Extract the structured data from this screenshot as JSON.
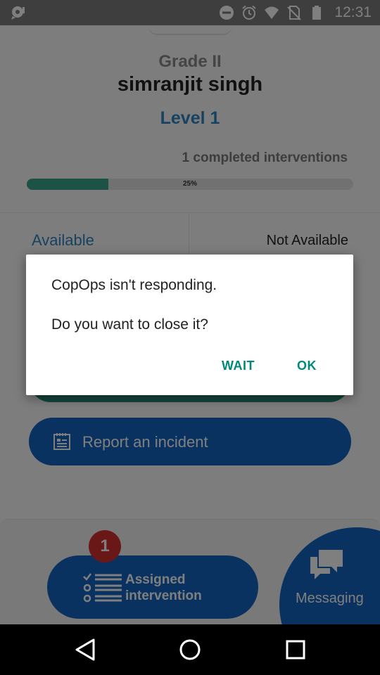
{
  "status_bar": {
    "time": "12:31",
    "icons": [
      "notification-icon",
      "do-not-disturb-icon",
      "alarm-icon",
      "wifi-icon",
      "no-sim-icon",
      "battery-icon"
    ]
  },
  "profile": {
    "grade": "Grade  II",
    "name": "simranjit singh",
    "level": "Level 1",
    "completed_text": "1 completed interventions",
    "progress_percent": 25,
    "progress_label": "25%"
  },
  "tabs": {
    "available": "Available",
    "not_available": "Not Available"
  },
  "report_button": {
    "label": "Report an incident"
  },
  "bottom": {
    "badge_count": "1",
    "assigned_line1": "Assigned",
    "assigned_line2": "intervention",
    "messaging_label": "Messaging"
  },
  "dialog": {
    "title": "CopOps isn't responding.",
    "message": "Do you want to close it?",
    "wait_label": "WAIT",
    "ok_label": "OK"
  },
  "colors": {
    "accent_teal": "#00897b",
    "primary_blue": "#1565c0",
    "progress_green": "#3aa48d",
    "badge_red": "#d32f2f"
  }
}
